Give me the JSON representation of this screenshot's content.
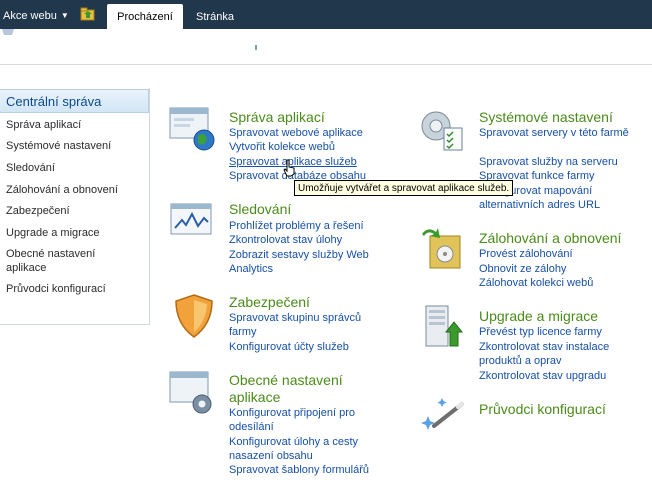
{
  "ribbon": {
    "site_actions": "Akce webu",
    "tabs": [
      {
        "label": "Procházení"
      },
      {
        "label": "Stránka"
      }
    ]
  },
  "sidebar": {
    "header": "Centrální správa",
    "items": [
      {
        "label": "Správa aplikací"
      },
      {
        "label": "Systémové nastavení"
      },
      {
        "label": "Sledování"
      },
      {
        "label": "Zálohování a obnovení"
      },
      {
        "label": "Zabezpečení"
      },
      {
        "label": "Upgrade a migrace"
      },
      {
        "label": "Obecné nastavení aplikace"
      },
      {
        "label": "Průvodci konfigurací"
      }
    ]
  },
  "groups": {
    "apps": {
      "title": "Správa aplikací",
      "icon": "application-globe-icon",
      "links": [
        "Spravovat webové aplikace",
        "Vytvořit kolekce webů",
        "Spravovat aplikace služeb",
        "Spravovat databáze obsahu"
      ]
    },
    "system": {
      "title": "Systémové nastavení",
      "icon": "server-gear-icon",
      "links": [
        "Spravovat servery v této farmě",
        "Spravovat služby na serveru",
        "Spravovat funkce farmy",
        "Konfigurovat mapování alternativních adres URL"
      ]
    },
    "monitoring": {
      "title": "Sledování",
      "icon": "monitor-graph-icon",
      "links": [
        "Prohlížet problémy a řešení",
        "Zkontrolovat stav úlohy",
        "Zobrazit sestavy služby Web Analytics"
      ]
    },
    "backup": {
      "title": "Zálohování a obnovení",
      "icon": "backup-restore-icon",
      "links": [
        "Provést zálohování",
        "Obnovit ze zálohy",
        "Zálohovat kolekci webů"
      ]
    },
    "security": {
      "title": "Zabezpečení",
      "icon": "shield-icon",
      "links": [
        "Spravovat skupinu správců farmy",
        "Konfigurovat účty služeb"
      ]
    },
    "upgrade": {
      "title": "Upgrade a migrace",
      "icon": "server-upgrade-icon",
      "links": [
        "Převést typ licence farmy",
        "Zkontrolovat stav instalace produktů a oprav",
        "Zkontrolovat stav upgradu"
      ]
    },
    "general": {
      "title": "Obecné nastavení aplikace",
      "icon": "application-settings-icon",
      "links": [
        "Konfigurovat připojení pro odesílání",
        "Konfigurovat úlohy a cesty nasazení obsahu",
        "Spravovat šablony formulářů"
      ]
    },
    "wizards": {
      "title": "Průvodci konfigurací",
      "icon": "magic-wand-icon",
      "links": []
    }
  },
  "tooltip": "Umožňuje vytvářet a spravovat aplikace služeb.",
  "colors": {
    "ribbon": "#21374c",
    "title_green": "#4a8b1a",
    "link_blue": "#1750a6",
    "nav_header": "#0c4a8c"
  }
}
